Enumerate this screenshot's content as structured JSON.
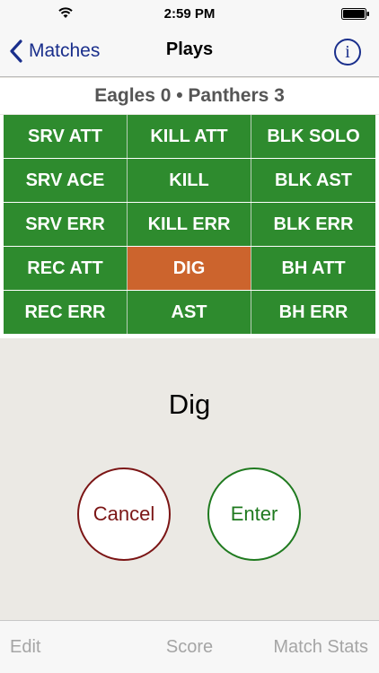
{
  "status_bar": {
    "time": "2:59 PM"
  },
  "nav": {
    "back_label": "Matches",
    "title": "Plays",
    "info_label": "i"
  },
  "score": {
    "text": "Eagles 0 • Panthers 3"
  },
  "grid": {
    "rows": [
      [
        "SRV ATT",
        "KILL ATT",
        "BLK SOLO"
      ],
      [
        "SRV ACE",
        "KILL",
        "BLK AST"
      ],
      [
        "SRV ERR",
        "KILL ERR",
        "BLK ERR"
      ],
      [
        "REC ATT",
        "DIG",
        "BH ATT"
      ],
      [
        "REC ERR",
        "AST",
        "BH ERR"
      ]
    ],
    "selected": "DIG"
  },
  "content": {
    "selected_play": "Dig",
    "cancel_label": "Cancel",
    "enter_label": "Enter"
  },
  "tabs": {
    "edit": "Edit",
    "score": "Score",
    "match_stats": "Match Stats"
  },
  "colors": {
    "cell_green": "#2e8b2e",
    "cell_selected": "#cc642d",
    "accent": "#1a2f8c"
  }
}
